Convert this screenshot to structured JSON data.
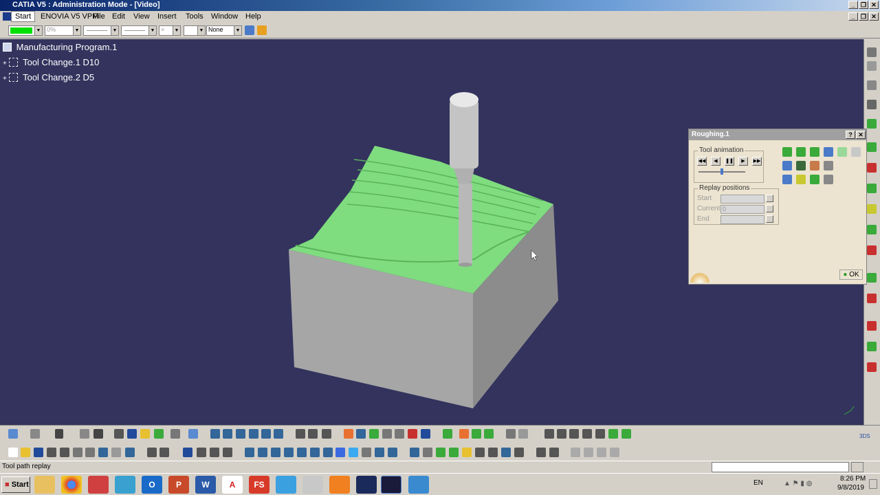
{
  "window": {
    "title": "CATIA V5 : Administration Mode - [Video]"
  },
  "menu": {
    "items": [
      "Start",
      "ENOVIA V5 VPM",
      "File",
      "Edit",
      "View",
      "Insert",
      "Tools",
      "Window",
      "Help"
    ]
  },
  "toolbar": {
    "color_value": "",
    "transparency": "0%",
    "layer": "None"
  },
  "tree": {
    "root": "Manufacturing Program.1",
    "children": [
      "Tool Change.1  D10",
      "Tool Change.2  D5"
    ]
  },
  "dialog": {
    "title": "Roughing.1",
    "help": "?",
    "close": "✕",
    "tool_animation": "Tool animation",
    "replay_positions": "Replay positions",
    "start_label": "Start",
    "current_label": "Current",
    "current_value": "0",
    "end_label": "End",
    "ok": "OK"
  },
  "status": {
    "text": "Tool path replay"
  },
  "taskbar": {
    "start": "Start",
    "lang": "EN",
    "time": "8:26 PM",
    "date": "9/8/2019"
  },
  "colors": {
    "viewport": "#33335e",
    "machined": "#7fdc7f",
    "stock": "#a6a6a6"
  }
}
